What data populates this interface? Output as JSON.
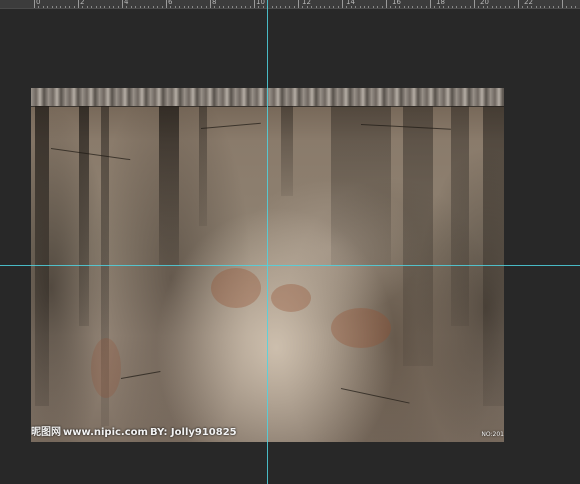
{
  "ruler": {
    "labels": [
      "0",
      "2",
      "4",
      "6",
      "8",
      "10",
      "12",
      "14",
      "16",
      "18",
      "20",
      "22"
    ]
  },
  "document": {
    "image_description_icon": "weathered-concrete-wall-texture"
  },
  "watermark": {
    "logo": "昵图网",
    "site": "www.nipic.com",
    "author": "BY: Jolly910825",
    "number": "NO:201"
  },
  "guides": {
    "color": "#4fd3e0"
  },
  "colors": {
    "workspace": "#282828",
    "ruler": "#3c3c3c"
  }
}
